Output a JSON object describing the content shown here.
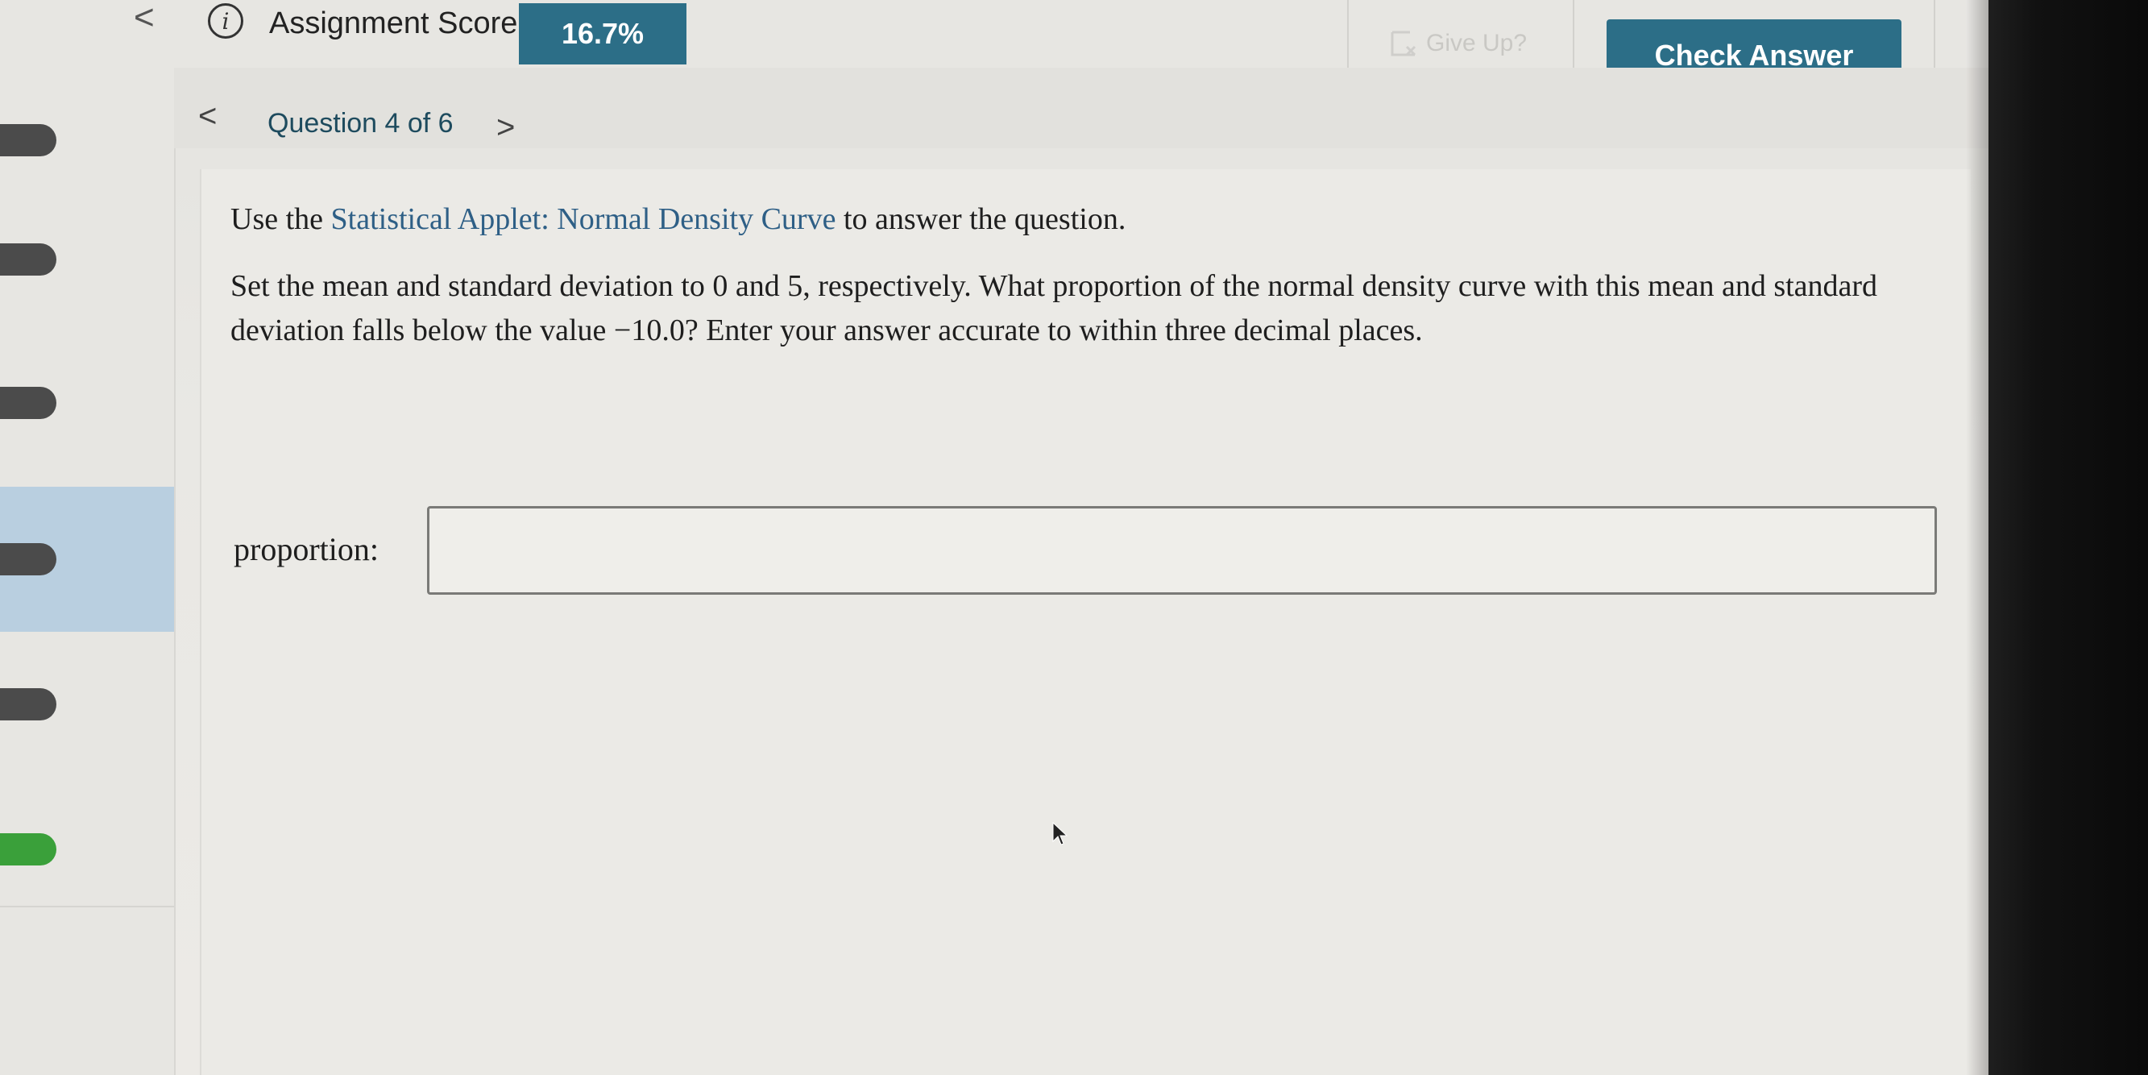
{
  "header": {
    "back_glyph": "<",
    "info_icon": "i",
    "score_label": "Assignment Score:",
    "score_value": "16.7%",
    "give_up_label": "Give Up?",
    "check_answer_label": "Check Answer",
    "accent_color": "#2c6e87"
  },
  "question_nav": {
    "prev_glyph": "<",
    "title": "Question 4 of 6",
    "next_glyph": ">"
  },
  "sidebar": {
    "items": [
      {
        "status": "attempted",
        "active": false
      },
      {
        "status": "attempted",
        "active": false
      },
      {
        "status": "attempted",
        "active": false
      },
      {
        "status": "attempted",
        "active": true
      },
      {
        "status": "attempted",
        "active": false
      },
      {
        "status": "correct",
        "active": false
      }
    ],
    "colors": {
      "attempted": "#4b4b4b",
      "correct": "#3aa03a",
      "active_bg": "#b9cfe0"
    }
  },
  "content": {
    "instruction_prefix": "Use the ",
    "applet_link": "Statistical Applet: Normal Density Curve",
    "instruction_suffix": " to answer the question.",
    "question_text": "Set the mean and standard deviation to 0 and 5, respectively. What proportion of the normal density curve with this mean and standard deviation falls below the value −10.0? Enter your answer accurate to within three decimal places.",
    "answer_label": "proportion:",
    "answer_value": ""
  }
}
